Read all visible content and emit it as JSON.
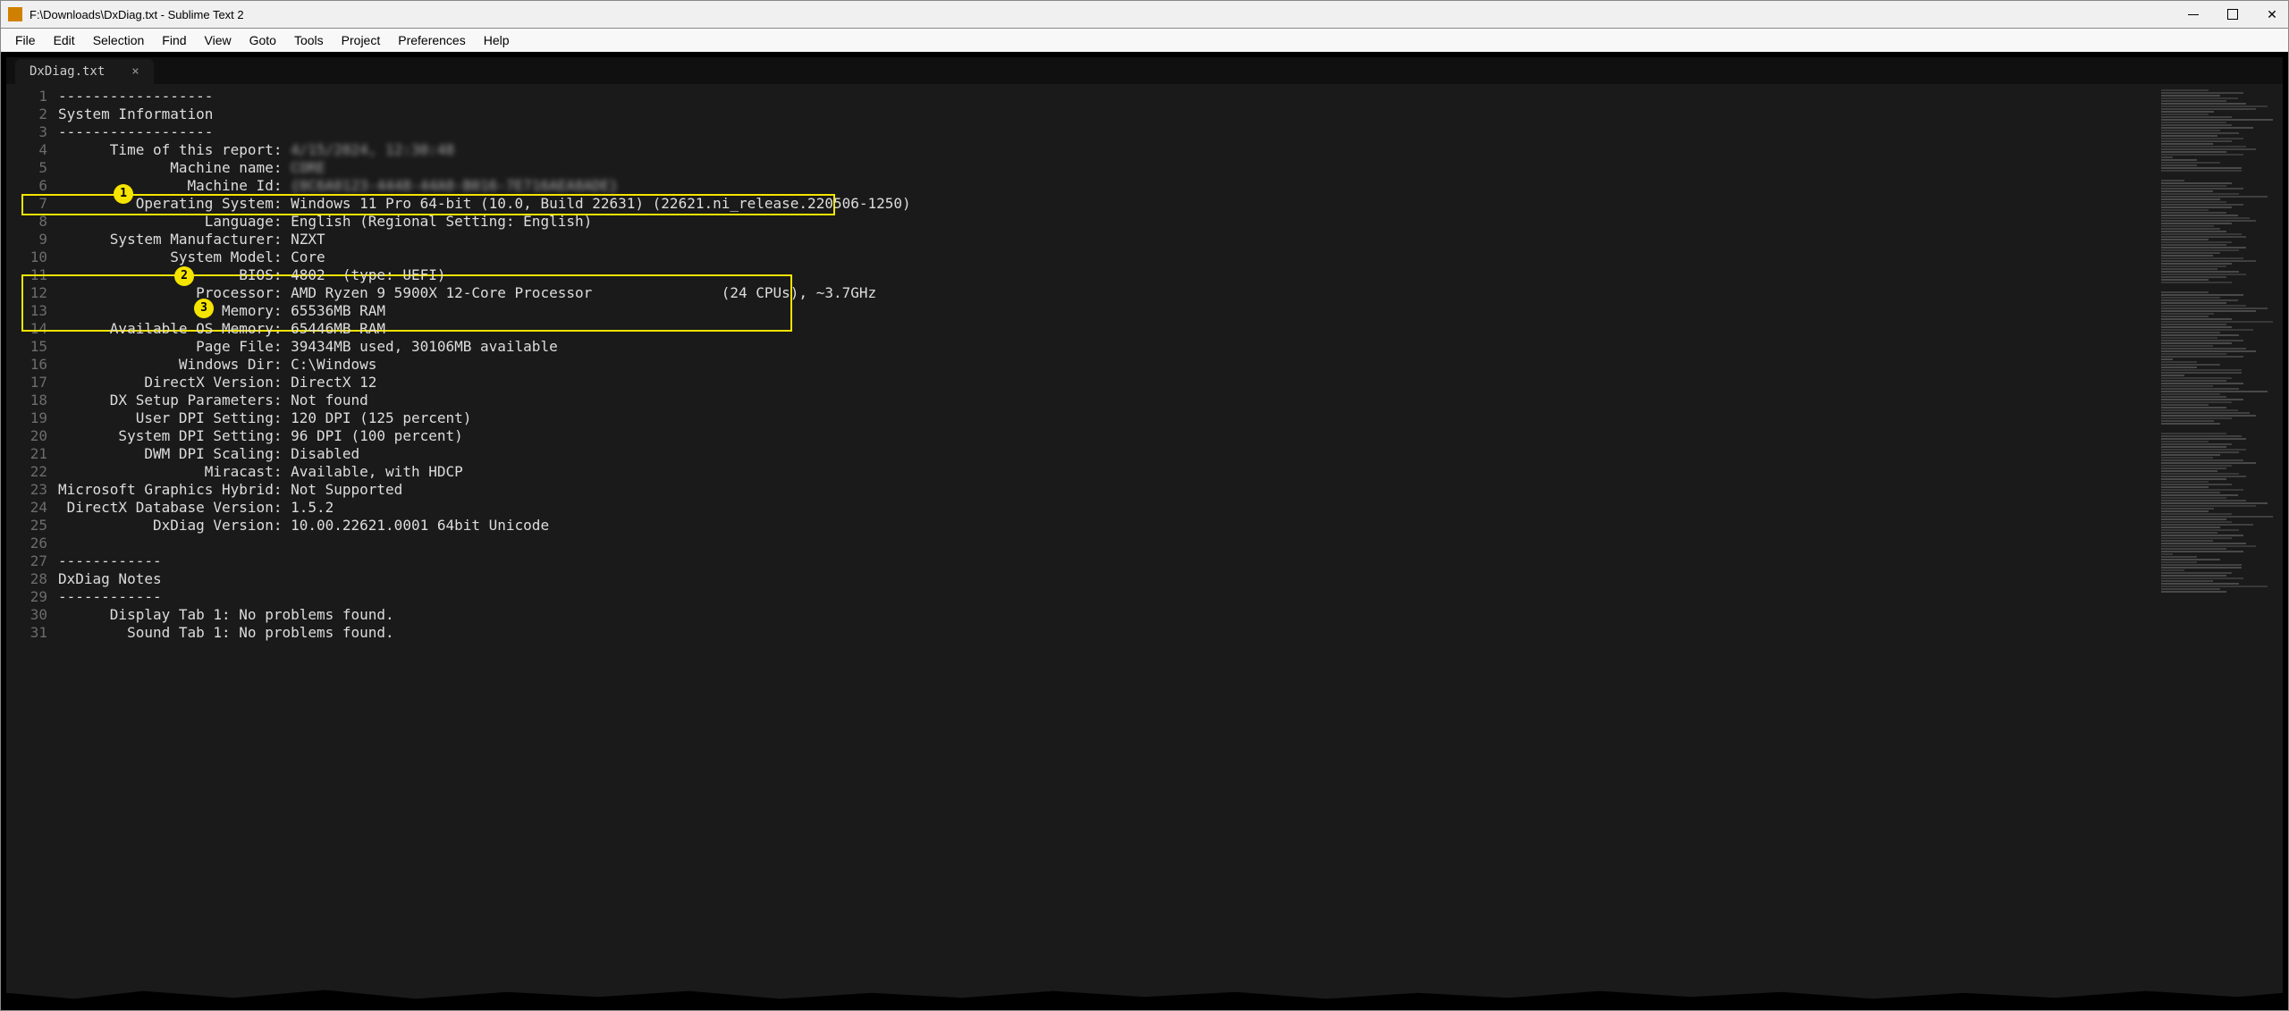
{
  "window": {
    "title": "F:\\Downloads\\DxDiag.txt - Sublime Text 2"
  },
  "menu": {
    "items": [
      "File",
      "Edit",
      "Selection",
      "Find",
      "View",
      "Goto",
      "Tools",
      "Project",
      "Preferences",
      "Help"
    ]
  },
  "tab": {
    "label": "DxDiag.txt",
    "close": "×"
  },
  "annotations": {
    "1": "1",
    "2": "2",
    "3": "3"
  },
  "code": {
    "lines": [
      "------------------",
      "System Information",
      "------------------",
      "      Time of this report: ",
      "             Machine name: ",
      "               Machine Id: ",
      "         Operating System: Windows 11 Pro 64-bit (10.0, Build 22631) (22621.ni_release.220506-1250)",
      "                 Language: English (Regional Setting: English)",
      "      System Manufacturer: NZXT",
      "             System Model: Core",
      "                     BIOS: 4802  (type: UEFI)",
      "                Processor: AMD Ryzen 9 5900X 12-Core Processor               (24 CPUs), ~3.7GHz",
      "                   Memory: 65536MB RAM",
      "      Available OS Memory: 65446MB RAM",
      "                Page File: 39434MB used, 30106MB available",
      "              Windows Dir: C:\\Windows",
      "          DirectX Version: DirectX 12",
      "      DX Setup Parameters: Not found",
      "         User DPI Setting: 120 DPI (125 percent)",
      "       System DPI Setting: 96 DPI (100 percent)",
      "          DWM DPI Scaling: Disabled",
      "                 Miracast: Available, with HDCP",
      "Microsoft Graphics Hybrid: Not Supported",
      " DirectX Database Version: 1.5.2",
      "           DxDiag Version: 10.00.22621.0001 64bit Unicode",
      "",
      "------------",
      "DxDiag Notes",
      "------------",
      "      Display Tab 1: No problems found.",
      "        Sound Tab 1: No problems found."
    ],
    "redacted": {
      "4": "4/15/2024, 12:30:48",
      "5": "CORE",
      "6": "{0C6A0123-4448-44A0-B016-7E716AEA8ADE}"
    }
  }
}
